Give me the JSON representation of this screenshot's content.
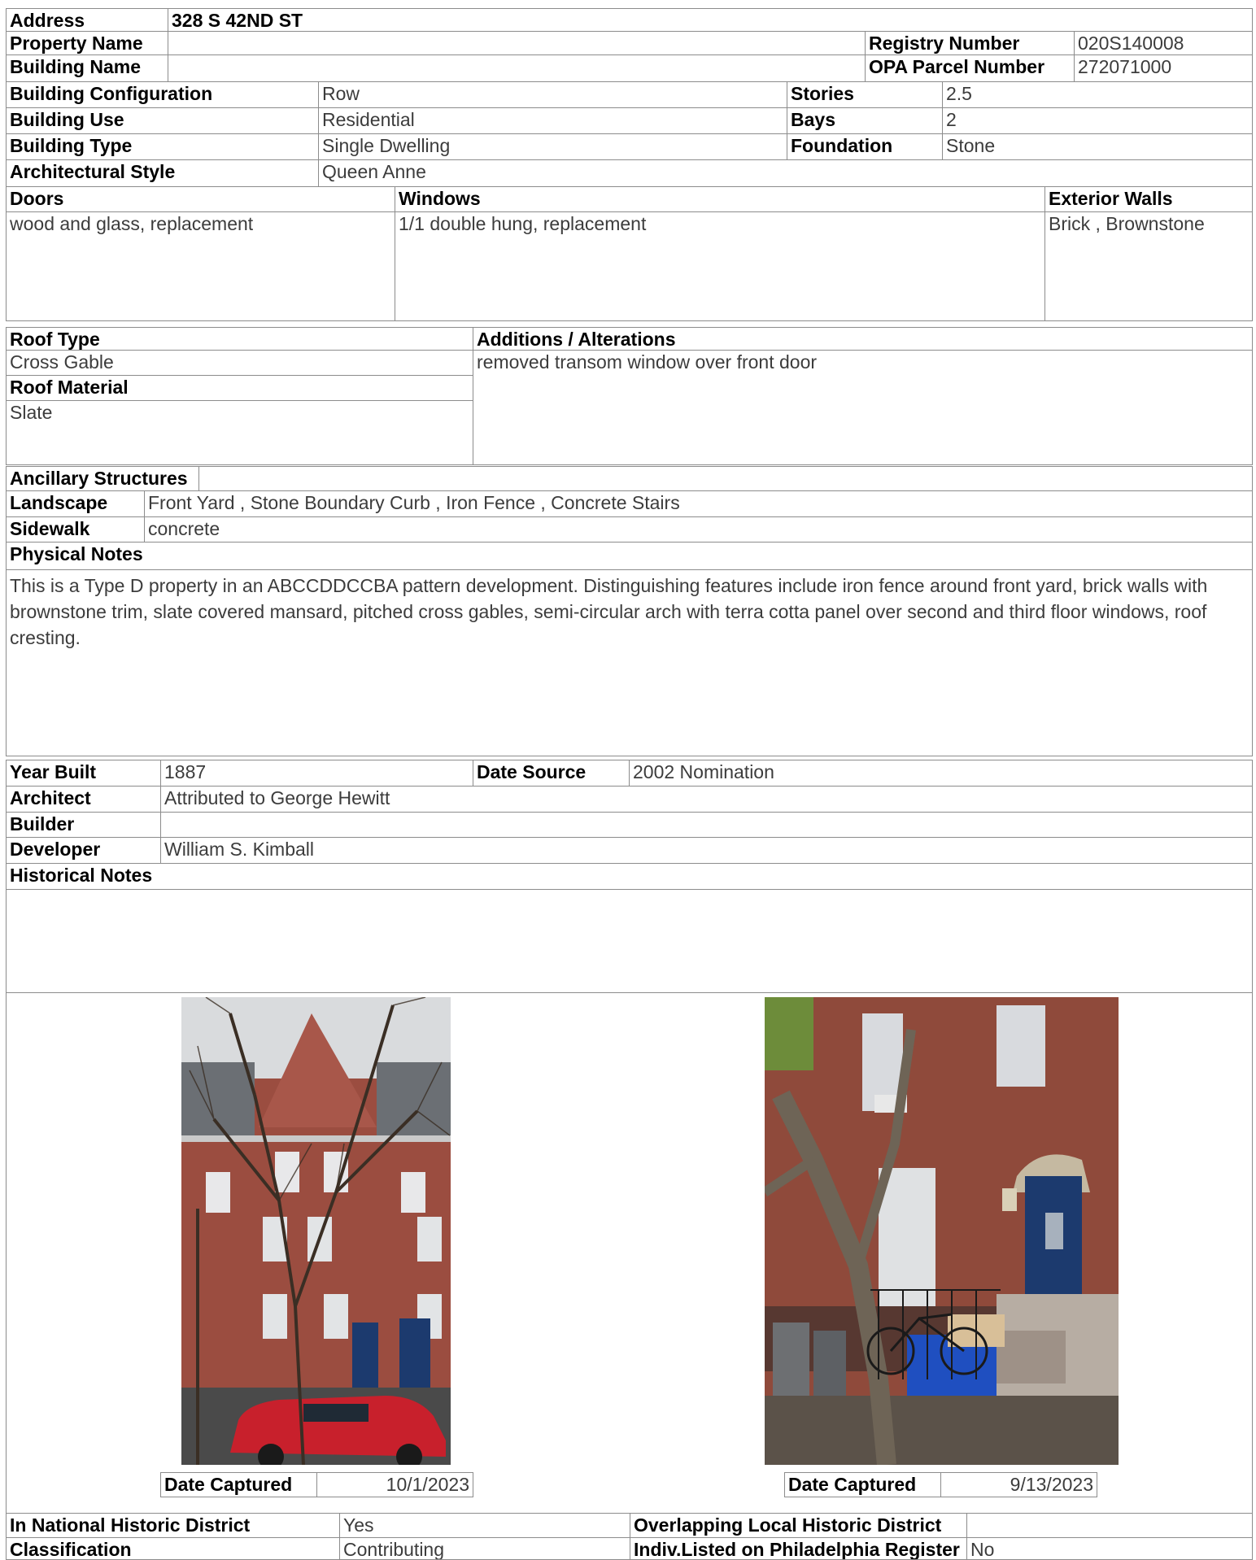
{
  "address": {
    "label": "Address",
    "value": "328 S 42ND ST"
  },
  "property_name": {
    "label": "Property Name",
    "value": ""
  },
  "registry_number": {
    "label": "Registry Number",
    "value": "020S140008"
  },
  "building_name": {
    "label": "Building Name",
    "value": ""
  },
  "opa_parcel_number": {
    "label": "OPA Parcel Number",
    "value": "272071000"
  },
  "building_configuration": {
    "label": "Building Configuration",
    "value": "Row"
  },
  "stories": {
    "label": "Stories",
    "value": "2.5"
  },
  "building_use": {
    "label": "Building Use",
    "value": "Residential"
  },
  "bays": {
    "label": "Bays",
    "value": "2"
  },
  "building_type": {
    "label": "Building Type",
    "value": "Single Dwelling"
  },
  "foundation": {
    "label": "Foundation",
    "value": "Stone"
  },
  "architectural_style": {
    "label": "Architectural Style",
    "value": "Queen Anne"
  },
  "doors": {
    "label": "Doors",
    "value": "wood and glass, replacement"
  },
  "windows": {
    "label": "Windows",
    "value": "1/1 double hung, replacement"
  },
  "exterior_walls": {
    "label": "Exterior Walls",
    "value": "Brick , Brownstone"
  },
  "roof_type": {
    "label": "Roof Type",
    "value": "Cross Gable"
  },
  "roof_material": {
    "label": "Roof Material",
    "value": "Slate"
  },
  "additions_alterations": {
    "label": "Additions / Alterations",
    "value": "removed transom window over front door"
  },
  "ancillary_structures": {
    "label": "Ancillary Structures",
    "value": ""
  },
  "landscape": {
    "label": "Landscape",
    "value": "Front Yard , Stone Boundary Curb , Iron Fence , Concrete Stairs"
  },
  "sidewalk": {
    "label": "Sidewalk",
    "value": "concrete"
  },
  "physical_notes": {
    "label": "Physical Notes",
    "value": "This is a Type D property in an ABCCDDCCBA pattern development. Distinguishing features include iron fence around front yard, brick walls with brownstone trim, slate covered mansard, pitched cross gables, semi-circular arch with terra cotta panel over second and third floor windows, roof cresting."
  },
  "year_built": {
    "label": "Year Built",
    "value": "1887"
  },
  "date_source": {
    "label": "Date Source",
    "value": "2002 Nomination"
  },
  "architect": {
    "label": "Architect",
    "value": "Attributed to George Hewitt"
  },
  "builder": {
    "label": "Builder",
    "value": ""
  },
  "developer": {
    "label": "Developer",
    "value": "William S. Kimball"
  },
  "historical_notes": {
    "label": "Historical Notes",
    "value": ""
  },
  "photos": [
    {
      "date_label": "Date Captured",
      "date": "10/1/2023"
    },
    {
      "date_label": "Date Captured",
      "date": "9/13/2023"
    }
  ],
  "national_historic_district": {
    "label": "In National Historic District",
    "value": "Yes"
  },
  "overlapping_local_district": {
    "label": "Overlapping Local Historic District",
    "value": ""
  },
  "classification": {
    "label": "Classification",
    "value": "Contributing"
  },
  "indiv_listed": {
    "label": "Indiv.Listed on Philadelphia Register",
    "value": "No"
  },
  "colors": {
    "border": "#8c8c8c",
    "value_text": "#3c3c3c",
    "brick": "#9a4a3c",
    "car": "#c8202c",
    "door": "#1c3a6e",
    "bin": "#1f4fc0"
  }
}
